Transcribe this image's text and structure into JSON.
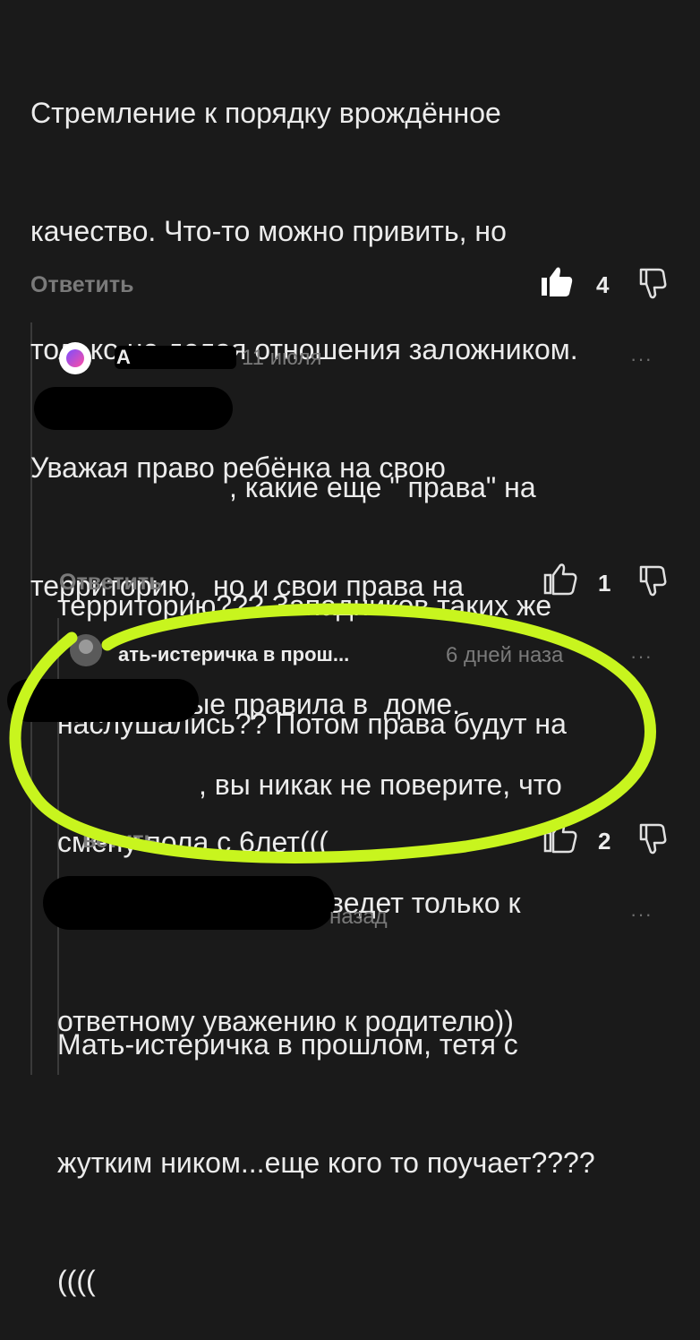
{
  "comments": [
    {
      "text_lines": [
        "Стремление к порядку врождённое",
        "качество. Что-то можно привить, но",
        "только не делая отношения заложником.",
        "Уважая право ребёнка на свою",
        "территорию,  но и свои права на",
        "определенные правила в  доме."
      ],
      "reply_label": "Ответить",
      "likes": "4"
    },
    {
      "author": "А",
      "date": "11 июля",
      "menu": "···",
      "text_lines": [
        ", какие еще \" права\" на",
        "территорию??? Западников таких же",
        "наслушались?? Потом права будут на",
        "смену пола с 6лет((("
      ],
      "reply_label": "Ответить",
      "likes": "1"
    },
    {
      "author": "ать-истеричка в прош...",
      "date": "6 дней наза",
      "menu": "···",
      "text_lines": [
        ", вы никак не поверите, что",
        "уважение к ребёнку ведет только к",
        "ответному уважению к родителю))"
      ],
      "reply_label": "ветить",
      "likes": "2"
    },
    {
      "date": "назад",
      "menu": "···",
      "text_lines": [
        "Мать-истеричка в прошлом, тетя с",
        "жутким ником...еще кого то поучает????",
        "(((("
      ]
    }
  ],
  "colors": {
    "background": "#1a1a1a",
    "text": "#ececec",
    "muted": "#7a7a7a",
    "highlight": "#c8f51e",
    "redaction": "#000000"
  },
  "icons": [
    "thumbs-up-icon",
    "thumbs-down-icon",
    "avatar-icon",
    "more-icon"
  ]
}
